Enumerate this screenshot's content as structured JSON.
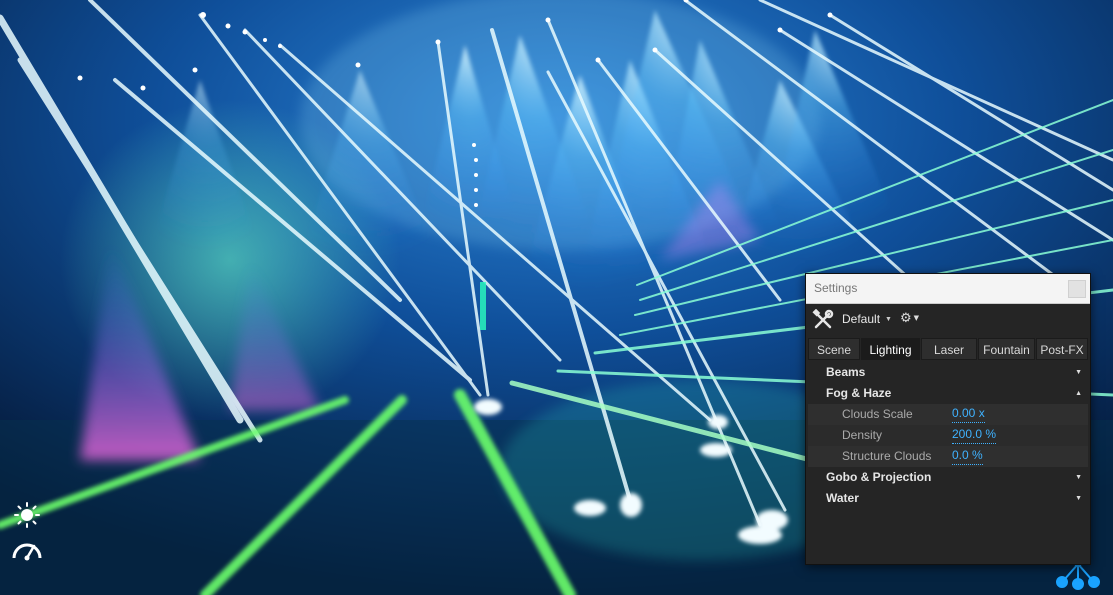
{
  "settings_window": {
    "title": "Settings",
    "preset": "Default",
    "tabs": [
      "Scene",
      "Lighting",
      "Laser",
      "Fountain",
      "Post-FX"
    ],
    "active_tab": "Lighting",
    "sections": {
      "beams": "Beams",
      "fog_haze": "Fog & Haze",
      "gobo": "Gobo & Projection",
      "water": "Water"
    },
    "fog_properties": [
      {
        "label": "Clouds Scale",
        "value": "0.00 x"
      },
      {
        "label": "Density",
        "value": "200.0 %"
      },
      {
        "label": "Structure Clouds",
        "value": "0.0 %"
      }
    ]
  },
  "icons": [
    "sun-icon",
    "speed-gauge-icon",
    "molecule-icon",
    "tools-icon",
    "gear-icon"
  ],
  "colors": {
    "accent": "#3fb2ff",
    "panel": "#252525",
    "beam_cyan": "#7fe8ff",
    "beam_green": "#6cff6c"
  }
}
